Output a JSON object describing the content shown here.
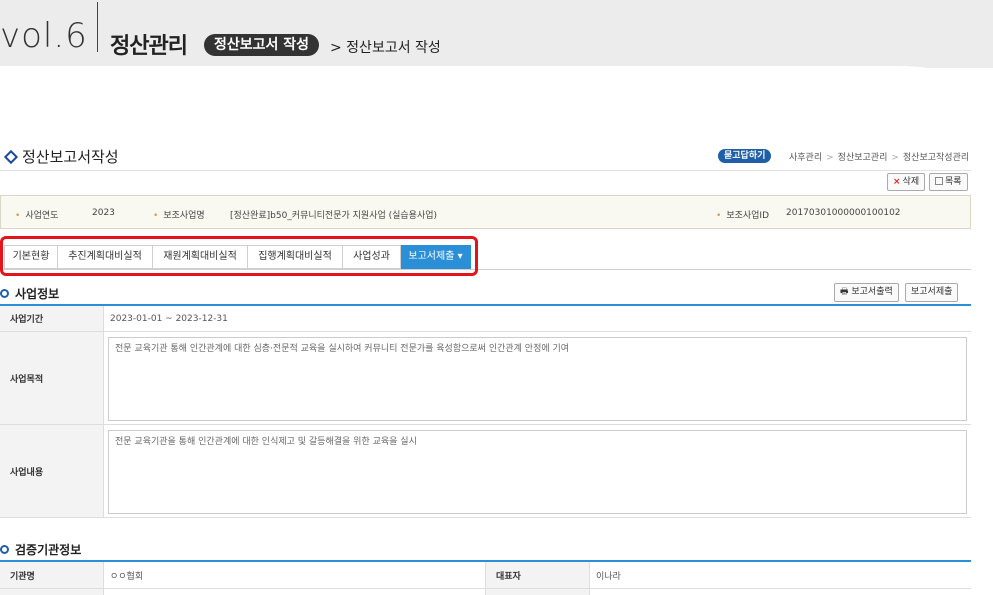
{
  "header": {
    "vol": "vol.6",
    "section_title": "정산관리",
    "section_pill": "정산보고서 작성",
    "section_crumb": "> 정산보고서 작성"
  },
  "page": {
    "title": "정산보고서작성",
    "qa_badge": "묻고답하기",
    "breadcrumb": [
      "사후관리",
      "정산보고관리",
      "정산보고작성관리"
    ],
    "delete_label": "삭제",
    "list_label": "목록"
  },
  "info": {
    "year_label": "사업연도",
    "year_value": "2023",
    "project_label": "보조사업명",
    "project_value": "[정산완료]b50_커뮤니티전문가 지원사업 (실습용사업)",
    "id_label": "보조사업ID",
    "id_value": "20170301000000100102"
  },
  "tabs": [
    {
      "label": "기본현황"
    },
    {
      "label": "추진계획대비실적"
    },
    {
      "label": "재원계획대비실적"
    },
    {
      "label": "집행계획대비실적"
    },
    {
      "label": "사업성과"
    },
    {
      "label": "보고서제출 ▾"
    }
  ],
  "business_info": {
    "heading": "사업정보",
    "print_label": "보고서출력",
    "submit_label": "보고서제출",
    "period_label": "사업기간",
    "period_value": "2023-01-01 ~ 2023-12-31",
    "purpose_label": "사업목적",
    "purpose_value": "전문 교육기관 통해 인간관계에 대한 심층·전문적  교육을 실시하여 커뮤니티 전문가를 육성함으로써 인간관계 안정에 기여",
    "content_label": "사업내용",
    "content_value": "전문 교육기관을 통해 인간관계에 대한 인식제고 및 갈등해결을 위한 교육을 실시"
  },
  "verification": {
    "heading": "검증기관정보",
    "org_label": "기관명",
    "org_value": "ㅇㅇ협회",
    "rep_label": "대표자",
    "rep_value": "이나라"
  },
  "colors": {
    "accent_blue": "#2a8fd6",
    "highlight_red": "#e4141a",
    "badge_blue": "#1f5fa8"
  }
}
